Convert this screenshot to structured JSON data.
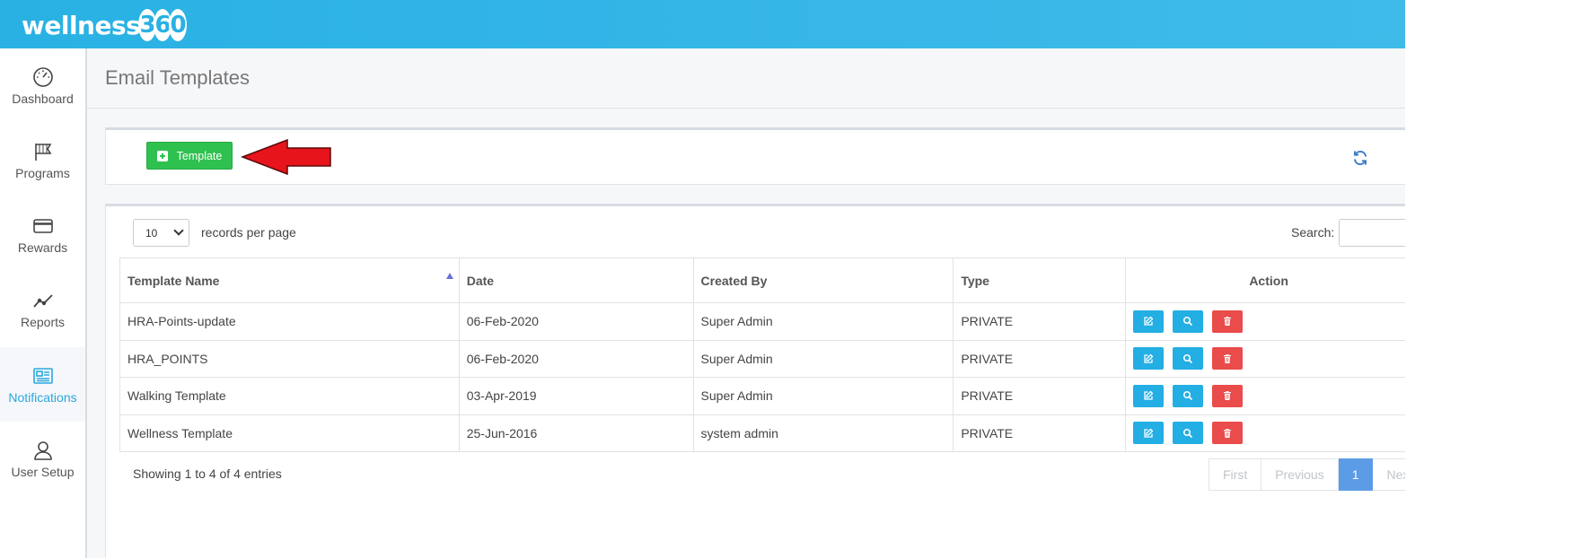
{
  "brand": {
    "name": "wellness",
    "num": [
      "3",
      "6",
      "0"
    ]
  },
  "sidebar": {
    "items": [
      {
        "label": "Dashboard",
        "icon": "gauge-icon",
        "active": false
      },
      {
        "label": "Programs",
        "icon": "flag-icon",
        "active": false
      },
      {
        "label": "Rewards",
        "icon": "card-icon",
        "active": false
      },
      {
        "label": "Reports",
        "icon": "chart-icon",
        "active": false
      },
      {
        "label": "Notifications",
        "icon": "newspaper-icon",
        "active": true
      },
      {
        "label": "User Setup",
        "icon": "user-icon",
        "active": false
      }
    ]
  },
  "page": {
    "title": "Email Templates"
  },
  "toolbar": {
    "add_label": "Template"
  },
  "table": {
    "length_value": "10",
    "length_label": "records per page",
    "search_label": "Search:",
    "columns": [
      "Template Name",
      "Date",
      "Created By",
      "Type",
      "Action"
    ],
    "rows": [
      {
        "name": "HRA-Points-update",
        "date": "06-Feb-2020",
        "created_by": "Super Admin",
        "type": "PRIVATE"
      },
      {
        "name": "HRA_POINTS",
        "date": "06-Feb-2020",
        "created_by": "Super Admin",
        "type": "PRIVATE"
      },
      {
        "name": "Walking Template",
        "date": "03-Apr-2019",
        "created_by": "Super Admin",
        "type": "PRIVATE"
      },
      {
        "name": "Wellness Template",
        "date": "25-Jun-2016",
        "created_by": "system admin",
        "type": "PRIVATE"
      }
    ],
    "info": "Showing 1 to 4 of 4 entries",
    "pager": {
      "first": "First",
      "previous": "Previous",
      "current": "1",
      "next": "Next"
    }
  },
  "colors": {
    "accent": "#29b1e3",
    "success": "#2fc14f",
    "danger": "#ea4b4b",
    "active_page": "#5c9ce6"
  }
}
